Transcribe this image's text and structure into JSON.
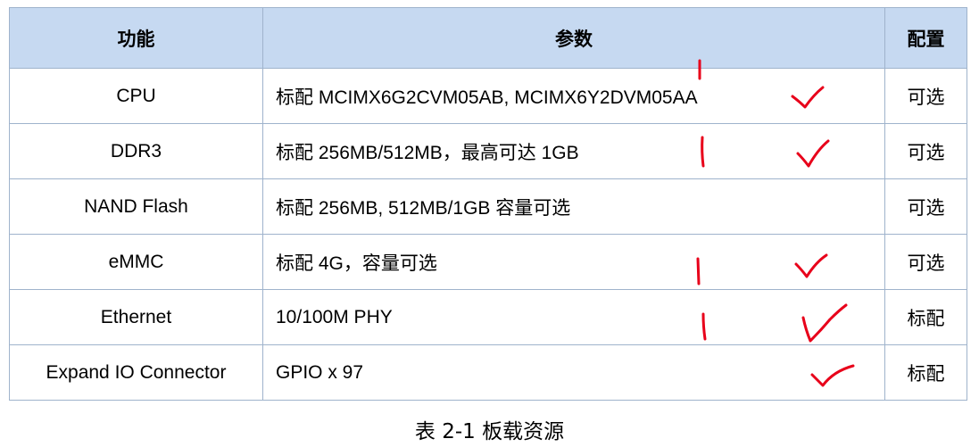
{
  "table": {
    "headers": [
      "功能",
      "参数",
      "配置"
    ],
    "rows": [
      {
        "function": "CPU",
        "parameter": "标配  MCIMX6G2CVM05AB, MCIMX6Y2DVM05AA",
        "config": "可选"
      },
      {
        "function": "DDR3",
        "parameter": "标配 256MB/512MB，最高可达 1GB",
        "config": "可选"
      },
      {
        "function": "NAND Flash",
        "parameter": "标配 256MB, 512MB/1GB 容量可选",
        "config": "可选"
      },
      {
        "function": "eMMC",
        "parameter": "标配 4G，容量可选",
        "config": "可选"
      },
      {
        "function": "Ethernet",
        "parameter": "10/100M PHY",
        "config": "标配"
      },
      {
        "function": "Expand IO Connector",
        "parameter": "GPIO x 97",
        "config": "标配"
      }
    ]
  },
  "caption": "表 2-1  板载资源",
  "annotation_color": "#e8001a"
}
